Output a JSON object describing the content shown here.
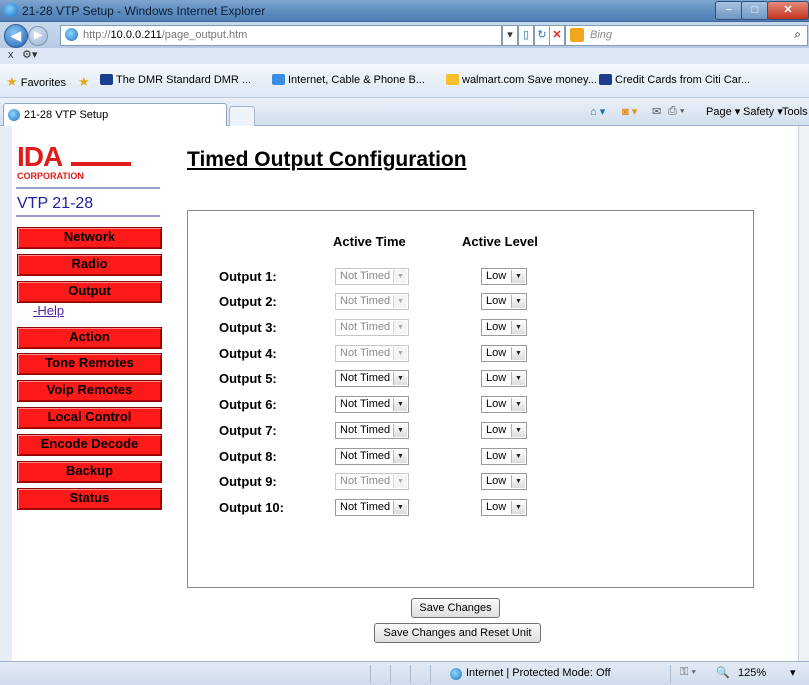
{
  "window": {
    "title": "21-28 VTP Setup - Windows Internet Explorer",
    "minimize_glyph": "−",
    "maximize_glyph": "□",
    "close_glyph": "✕"
  },
  "browser": {
    "url_prefix": "http://",
    "url_host": "10.0.0.211",
    "url_path": "/page_output.htm",
    "search_placeholder": "Bing",
    "x_glyph": "x",
    "favorites_label": "Favorites",
    "favorites": [
      "The DMR Standard  DMR ...",
      "Internet, Cable & Phone B...",
      "walmart.com Save money...",
      "Credit Cards from Citi Car..."
    ],
    "tab_title": "21-28 VTP Setup",
    "commands": [
      "Page ▾",
      "Safety ▾",
      "Tools ▾"
    ],
    "status_zone": "Internet | Protected Mode: Off",
    "zoom": "125%"
  },
  "sidebar": {
    "logo_text": "IDA",
    "logo_subtext": "CORPORATION",
    "device_name": "VTP 21-28",
    "items": [
      "Network",
      "Radio",
      "Output",
      "Action",
      "Tone Remotes",
      "Voip Remotes",
      "Local Control",
      "Encode Decode",
      "Backup",
      "Status"
    ],
    "help_link": "-Help"
  },
  "page": {
    "title": "Timed Output Configuration",
    "col_active_time": "Active Time",
    "col_active_level": "Active Level",
    "outputs": [
      {
        "label": "Output 1:",
        "time": "Not Timed",
        "time_enabled": false,
        "level": "Low"
      },
      {
        "label": "Output 2:",
        "time": "Not Timed",
        "time_enabled": false,
        "level": "Low"
      },
      {
        "label": "Output 3:",
        "time": "Not Timed",
        "time_enabled": false,
        "level": "Low"
      },
      {
        "label": "Output 4:",
        "time": "Not Timed",
        "time_enabled": false,
        "level": "Low"
      },
      {
        "label": "Output 5:",
        "time": "Not Timed",
        "time_enabled": true,
        "level": "Low"
      },
      {
        "label": "Output 6:",
        "time": "Not Timed",
        "time_enabled": true,
        "level": "Low"
      },
      {
        "label": "Output 7:",
        "time": "Not Timed",
        "time_enabled": true,
        "level": "Low"
      },
      {
        "label": "Output 8:",
        "time": "Not Timed",
        "time_enabled": true,
        "level": "Low"
      },
      {
        "label": "Output 9:",
        "time": "Not Timed",
        "time_enabled": false,
        "level": "Low"
      },
      {
        "label": "Output 10:",
        "time": "Not Timed",
        "time_enabled": true,
        "level": "Low"
      }
    ],
    "save_button": "Save Changes",
    "save_reset_button": "Save Changes and Reset Unit"
  },
  "colors": {
    "nav_red": "#ff1a1a",
    "logo_red": "#e01b1b",
    "device_blue": "#20209a"
  }
}
